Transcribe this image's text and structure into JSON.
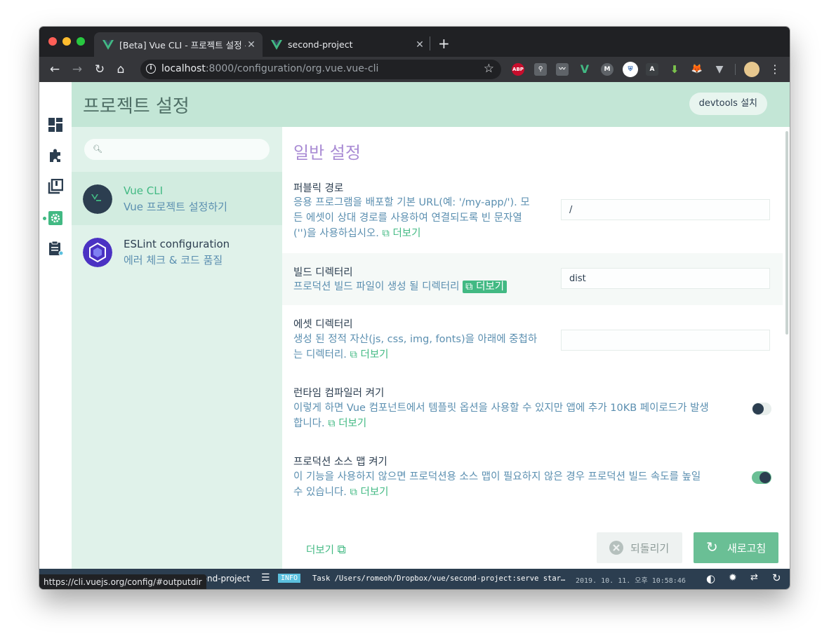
{
  "browser": {
    "tabs": [
      {
        "title": "[Beta] Vue CLI - 프로젝트 설정 - Vue CLI",
        "active": true
      },
      {
        "title": "second-project",
        "active": false
      }
    ],
    "url_host": "localhost",
    "url_rest": ":8000/configuration/org.vue.vue-cli",
    "extensions": [
      "ABP",
      "ghostery-icon",
      "chart-icon",
      "vue-devtools-icon",
      "metamask-M-icon",
      "shield-icon",
      "A-icon",
      "download-icon",
      "fox-icon",
      "V-icon",
      "avatar-icon"
    ],
    "status_url": "https://cli.vuejs.org/config/#outputdir"
  },
  "header": {
    "page_title": "프로젝트 설정",
    "devtools_label": "devtools 설치"
  },
  "sidebar": {
    "search_placeholder": "",
    "plugins": [
      {
        "name": "Vue CLI",
        "description": "Vue 프로젝트 설정하기",
        "selected": true
      },
      {
        "name": "ESLint configuration",
        "description": "에러 체크 & 코드 품질",
        "selected": false
      }
    ]
  },
  "main": {
    "section_title": "일반 설정",
    "settings": [
      {
        "label": "퍼블릭 경로",
        "desc_lines": [
          "응용 프로그램을 배포할 기본 URL(예: '/my-app/'). 모",
          "든 에셋이 상대 경로를 사용하여 연결되도록 빈 문자열",
          "('')을 사용하십시오."
        ],
        "more": "더보기",
        "value": "/"
      },
      {
        "label": "빌드 디렉터리",
        "desc_lines": [
          "프로덕션 빌드 파일이 생성 될 디렉터리"
        ],
        "more": "더보기",
        "value": "dist"
      },
      {
        "label": "에셋 디렉터리",
        "desc_lines": [
          "생성 된 정적 자산(js, css, img, fonts)을 아래에 중첩하",
          "는 디렉터리."
        ],
        "more": "더보기",
        "value": ""
      },
      {
        "label": "런타임 컴파일러 켜기",
        "desc_lines": [
          "이렇게 하면 Vue 컴포넌트에서 템플릿 옵션을 사용할 수 있지만 앱에 추가 10KB 페이로드가 발생",
          "합니다."
        ],
        "more": "더보기",
        "toggle": false
      },
      {
        "label": "프로덕션 소스 맵 켜기",
        "desc_lines": [
          "이 기능을 사용하지 않으면 프로덕션용 소스 맵이 필요하지 않은 경우 프로덕션 빌드 속도를 높일",
          "수 있습니다."
        ],
        "more": "더보기",
        "toggle": true
      }
    ]
  },
  "footer": {
    "more_label": "더보기",
    "reset_label": "되돌리기",
    "refresh_label": "새로고침"
  },
  "statusbar": {
    "project_path": "e/second-project",
    "log_level": "INFO",
    "log_message": "Task /Users/romeoh/Dropbox/vue/second-project:serve star…",
    "timestamp": "2019. 10. 11. 오후 10:58:46"
  },
  "colors": {
    "accent": "#42b983",
    "header_bg": "#c3e6d6",
    "sidebar_bg": "#e0f2ea",
    "section_title": "#a98bd4",
    "description": "#5b8fb0",
    "statusbar_bg": "#2c3e50"
  }
}
